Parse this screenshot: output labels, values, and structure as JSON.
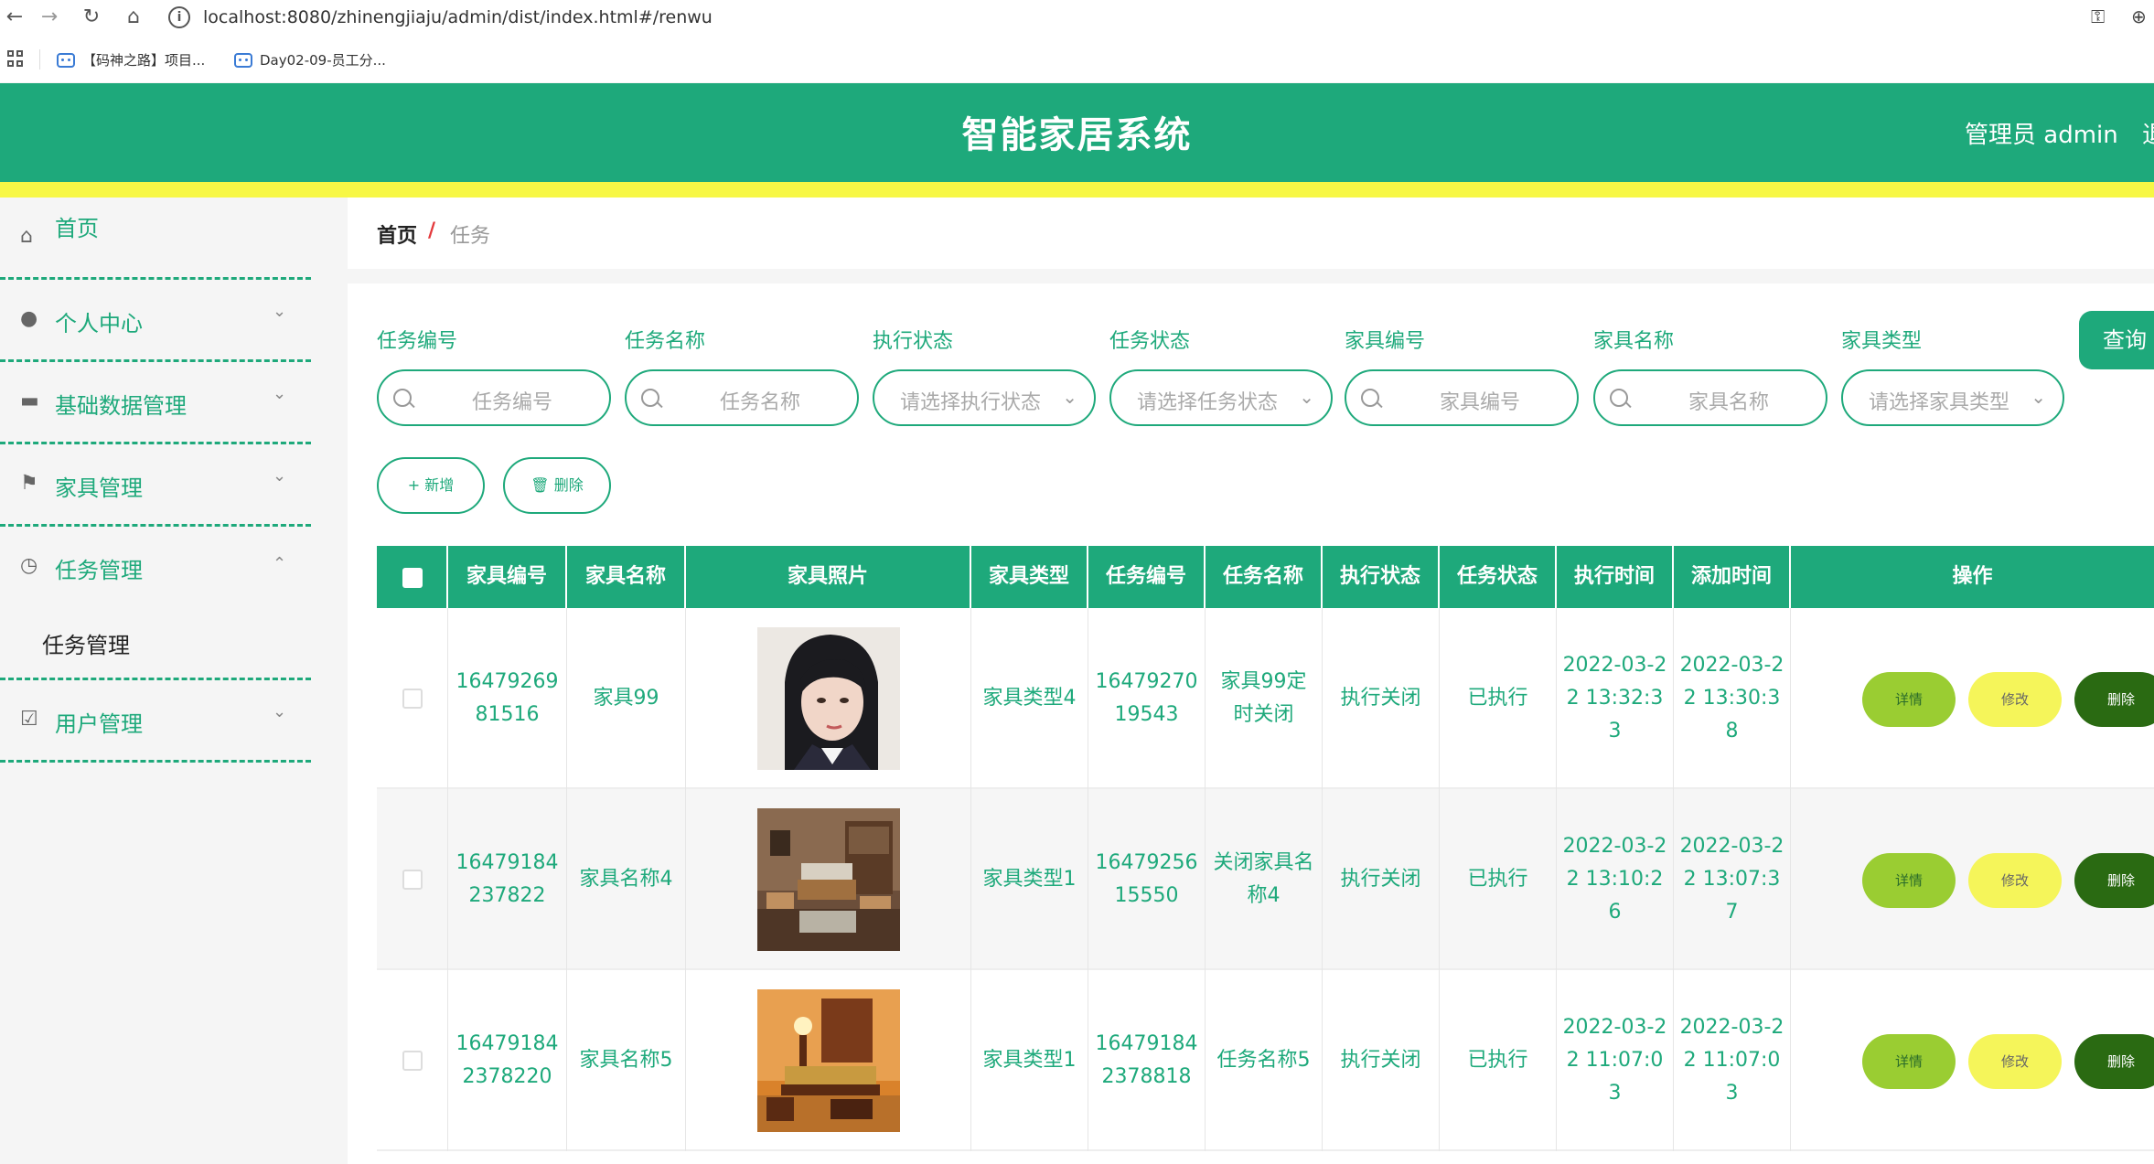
{
  "browser": {
    "url": "localhost:8080/zhinengjiaju/admin/dist/index.html#/renwu",
    "bookmarks": [
      "【码神之路】项目...",
      "Day02-09-员工分..."
    ]
  },
  "header": {
    "title": "智能家居系统",
    "user": "管理员 admin",
    "logout": "退"
  },
  "sidebar": {
    "items": [
      {
        "label": "首页",
        "icon": "home-icon"
      },
      {
        "label": "个人中心",
        "icon": "user-icon"
      },
      {
        "label": "基础数据管理",
        "icon": "chat-icon"
      },
      {
        "label": "家具管理",
        "icon": "flag-icon"
      },
      {
        "label": "任务管理",
        "icon": "clock-icon"
      },
      {
        "label": "用户管理",
        "icon": "clipboard-icon"
      }
    ],
    "submenu": {
      "label": "任务管理"
    }
  },
  "breadcrumb": {
    "home": "首页",
    "separator": "/",
    "current": "任务"
  },
  "filters": {
    "labels": [
      "任务编号",
      "任务名称",
      "执行状态",
      "任务状态",
      "家具编号",
      "家具名称",
      "家具类型"
    ],
    "placeholders": [
      "任务编号",
      "任务名称",
      "请选择执行状态",
      "请选择任务状态",
      "家具编号",
      "家具名称",
      "请选择家具类型"
    ],
    "query": "查询"
  },
  "toolbar": {
    "add": "+ 新增",
    "delete": "🗑 删除"
  },
  "table": {
    "columns": [
      "家具编号",
      "家具名称",
      "家具照片",
      "家具类型",
      "任务编号",
      "任务名称",
      "执行状态",
      "任务状态",
      "执行时间",
      "添加时间",
      "操作"
    ],
    "rows": [
      {
        "furniture_no": "1647926981516",
        "furniture_name": "家具99",
        "photo": "portrait-photo",
        "furniture_type": "家具类型4",
        "task_no": "1647927019543",
        "task_name": "家具99定时关闭",
        "exec_status": "执行关闭",
        "task_status": "已执行",
        "exec_time": "2022-03-22 13:32:33",
        "add_time": "2022-03-22 13:30:38"
      },
      {
        "furniture_no": "16479184237822",
        "furniture_name": "家具名称4",
        "photo": "living-room-photo",
        "furniture_type": "家具类型1",
        "task_no": "1647925615550",
        "task_name": "关闭家具名称4",
        "exec_status": "执行关闭",
        "task_status": "已执行",
        "exec_time": "2022-03-22 13:10:26",
        "add_time": "2022-03-22 13:07:37"
      },
      {
        "furniture_no": "164791842378220",
        "furniture_name": "家具名称5",
        "photo": "sofa-room-photo",
        "furniture_type": "家具类型1",
        "task_no": "164791842378818",
        "task_name": "任务名称5",
        "exec_status": "执行关闭",
        "task_status": "已执行",
        "exec_time": "2022-03-22 11:07:03",
        "add_time": "2022-03-22 11:07:03"
      }
    ],
    "actions": {
      "detail": "详情",
      "edit": "修改",
      "delete": "删除"
    }
  },
  "colors": {
    "primary": "#1ea97b",
    "accent_bar": "#f7f745",
    "detail_btn": "#9acd32",
    "edit_btn": "#f5f55a",
    "delete_btn": "#2a6a12"
  }
}
